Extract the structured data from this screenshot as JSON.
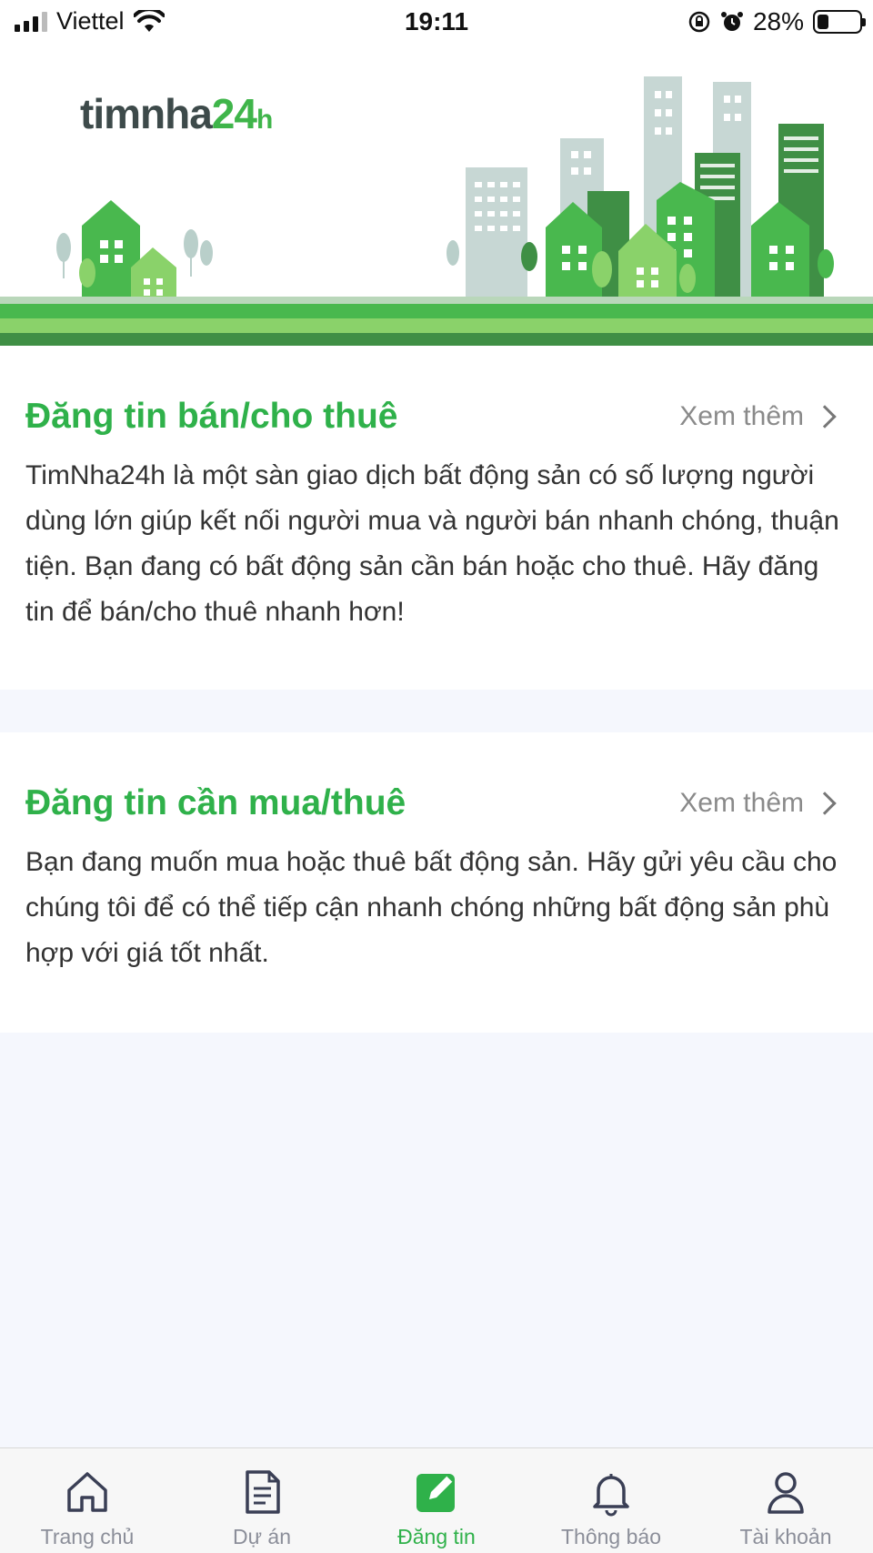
{
  "status_bar": {
    "carrier": "Viettel",
    "time": "19:11",
    "battery": "28%",
    "battery_level": 0.28
  },
  "banner": {
    "logo_main": "timnha",
    "logo_num": "24",
    "logo_h": "h"
  },
  "sections": [
    {
      "title": "Đăng tin bán/cho thuê",
      "see_more": "Xem thêm",
      "description": "TimNha24h là một sàn giao dịch bất động sản có số lượng người dùng lớn giúp kết nối người mua và người bán nhanh chóng, thuận tiện. Bạn đang có bất động sản cần bán hoặc cho thuê. Hãy đăng tin để bán/cho thuê nhanh hơn!"
    },
    {
      "title": "Đăng tin cần mua/thuê",
      "see_more": "Xem thêm",
      "description": "Bạn đang muốn mua hoặc thuê bất động sản. Hãy gửi yêu cầu cho chúng tôi để có thể tiếp cận nhanh chóng những bất động sản phù hợp với giá tốt nhất."
    }
  ],
  "bottom_nav": {
    "items": [
      {
        "label": "Trang chủ",
        "icon": "home-icon"
      },
      {
        "label": "Dự án",
        "icon": "document-icon"
      },
      {
        "label": "Đăng tin",
        "icon": "edit-icon",
        "active": true
      },
      {
        "label": "Thông báo",
        "icon": "bell-icon"
      },
      {
        "label": "Tài khoản",
        "icon": "user-icon"
      }
    ]
  },
  "colors": {
    "accent": "#2fb14a",
    "background": "#f5f7fd",
    "inactive": "#8b8e99"
  }
}
